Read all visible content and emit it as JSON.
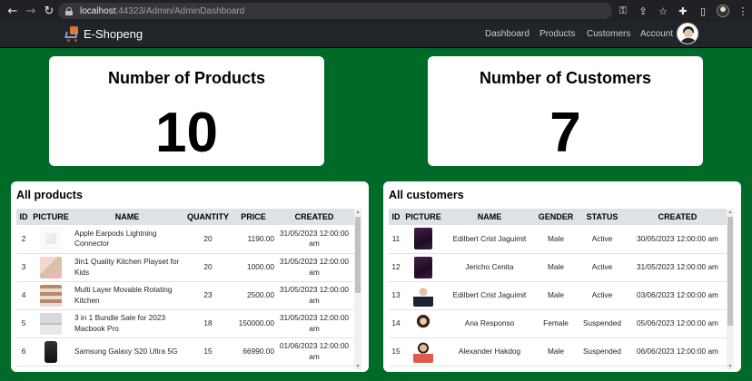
{
  "browser": {
    "url_host": "localhost",
    "url_rest": ":44323/Admin/AdminDashboard"
  },
  "navbar": {
    "brand": "E-Shopeng",
    "links": [
      "Dashboard",
      "Products",
      "Customers",
      "Account"
    ]
  },
  "stats": {
    "products_title": "Number of Products",
    "products_value": "10",
    "customers_title": "Number of Customers",
    "customers_value": "7"
  },
  "products": {
    "title": "All products",
    "columns": [
      "ID",
      "PICTURE",
      "NAME",
      "QUANTITY",
      "PRICE",
      "CREATED"
    ],
    "rows": [
      {
        "id": "2",
        "name": "Apple Earpods Lightning Connector",
        "quantity": "20",
        "price": "1190.00",
        "created": "31/05/2023 12:00:00 am",
        "thumb": "earpods"
      },
      {
        "id": "3",
        "name": "3in1 Quality Kitchen Playset for Kids",
        "quantity": "20",
        "price": "1000.00",
        "created": "31/05/2023 12:00:00 am",
        "thumb": "playset"
      },
      {
        "id": "4",
        "name": "Multi Layer Movable Rotating Kitchen",
        "quantity": "23",
        "price": "2500.00",
        "created": "31/05/2023 12:00:00 am",
        "thumb": "rack"
      },
      {
        "id": "5",
        "name": "3 in 1 Bundle Sale for 2023 Macbook Pro",
        "quantity": "18",
        "price": "150000.00",
        "created": "31/05/2023 12:00:00 am",
        "thumb": "macbook"
      },
      {
        "id": "6",
        "name": "Samsung Galaxy S20 Ultra 5G",
        "quantity": "15",
        "price": "66990.00",
        "created": "01/06/2023 12:00:00 am",
        "thumb": "phone"
      }
    ]
  },
  "customers": {
    "title": "All customers",
    "columns": [
      "ID",
      "PICTURE",
      "NAME",
      "GENDER",
      "STATUS",
      "CREATED"
    ],
    "rows": [
      {
        "id": "11",
        "name": "Edilbert Crist Jaguimit",
        "gender": "Male",
        "status": "Active",
        "created": "30/05/2023 12:00:00 am",
        "thumb": "dark"
      },
      {
        "id": "12",
        "name": "Jericho Cenita",
        "gender": "Male",
        "status": "Active",
        "created": "31/05/2023 12:00:00 am",
        "thumb": "dark"
      },
      {
        "id": "13",
        "name": "Edilbert Crist Jaguimit",
        "gender": "Male",
        "status": "Active",
        "created": "03/06/2023 12:00:00 am",
        "thumb": "suit"
      },
      {
        "id": "14",
        "name": "Ana Responso",
        "gender": "Female",
        "status": "Suspended",
        "created": "05/06/2023 12:00:00 am",
        "thumb": "woman"
      },
      {
        "id": "15",
        "name": "Alexander Hakdog",
        "gender": "Male",
        "status": "Suspended",
        "created": "06/06/2023 12:00:00 am",
        "thumb": "man"
      }
    ]
  },
  "colors": {
    "page_background": "#006a28",
    "navbar": "#212529",
    "header_row": "#dee2e6"
  }
}
